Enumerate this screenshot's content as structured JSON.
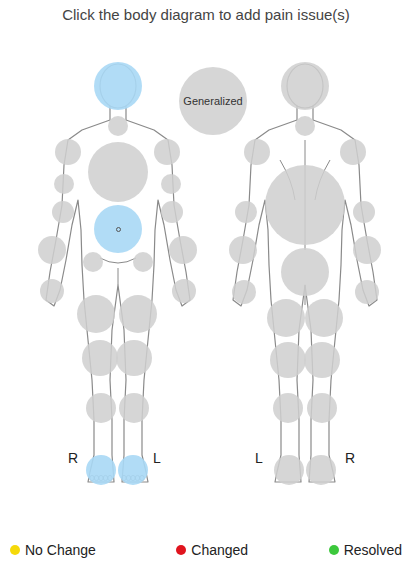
{
  "title": "Click the body diagram to add pain issue(s)",
  "generalized": {
    "label": "Generalized",
    "selected": false
  },
  "front": {
    "side_labels": [
      "R",
      "L"
    ],
    "regions": [
      {
        "name": "head",
        "selected": true,
        "marked": false
      },
      {
        "name": "neck",
        "selected": false,
        "marked": false
      },
      {
        "name": "right-shoulder",
        "selected": false,
        "marked": false
      },
      {
        "name": "left-shoulder",
        "selected": false,
        "marked": false
      },
      {
        "name": "chest",
        "selected": false,
        "marked": false
      },
      {
        "name": "right-upper-arm",
        "selected": false,
        "marked": false
      },
      {
        "name": "left-upper-arm",
        "selected": false,
        "marked": false
      },
      {
        "name": "right-elbow",
        "selected": false,
        "marked": false
      },
      {
        "name": "left-elbow",
        "selected": false,
        "marked": false
      },
      {
        "name": "abdomen",
        "selected": true,
        "marked": true
      },
      {
        "name": "right-forearm",
        "selected": false,
        "marked": false
      },
      {
        "name": "left-forearm",
        "selected": false,
        "marked": false
      },
      {
        "name": "right-hip",
        "selected": false,
        "marked": false
      },
      {
        "name": "left-hip",
        "selected": false,
        "marked": false
      },
      {
        "name": "right-hand",
        "selected": false,
        "marked": false
      },
      {
        "name": "left-hand",
        "selected": false,
        "marked": false
      },
      {
        "name": "right-upper-thigh",
        "selected": false,
        "marked": false
      },
      {
        "name": "left-upper-thigh",
        "selected": false,
        "marked": false
      },
      {
        "name": "right-lower-thigh",
        "selected": false,
        "marked": false
      },
      {
        "name": "left-lower-thigh",
        "selected": false,
        "marked": false
      },
      {
        "name": "right-knee",
        "selected": false,
        "marked": false
      },
      {
        "name": "left-knee",
        "selected": false,
        "marked": false
      },
      {
        "name": "right-foot",
        "selected": true,
        "marked": false
      },
      {
        "name": "left-foot",
        "selected": true,
        "marked": false
      }
    ]
  },
  "back": {
    "side_labels": [
      "L",
      "R"
    ],
    "regions": [
      {
        "name": "back-of-head",
        "selected": false,
        "marked": false
      },
      {
        "name": "back-of-neck",
        "selected": false,
        "marked": false
      },
      {
        "name": "left-shoulder-back",
        "selected": false,
        "marked": false
      },
      {
        "name": "right-shoulder-back",
        "selected": false,
        "marked": false
      },
      {
        "name": "upper-back",
        "selected": false,
        "marked": false
      },
      {
        "name": "left-elbow-back",
        "selected": false,
        "marked": false
      },
      {
        "name": "right-elbow-back",
        "selected": false,
        "marked": false
      },
      {
        "name": "left-forearm-back",
        "selected": false,
        "marked": false
      },
      {
        "name": "right-forearm-back",
        "selected": false,
        "marked": false
      },
      {
        "name": "lower-back",
        "selected": false,
        "marked": false
      },
      {
        "name": "left-hand-back",
        "selected": false,
        "marked": false
      },
      {
        "name": "right-hand-back",
        "selected": false,
        "marked": false
      },
      {
        "name": "left-buttock",
        "selected": false,
        "marked": false
      },
      {
        "name": "right-buttock",
        "selected": false,
        "marked": false
      },
      {
        "name": "left-hamstring",
        "selected": false,
        "marked": false
      },
      {
        "name": "right-hamstring",
        "selected": false,
        "marked": false
      },
      {
        "name": "left-calf",
        "selected": false,
        "marked": false
      },
      {
        "name": "right-calf",
        "selected": false,
        "marked": false
      },
      {
        "name": "left-heel",
        "selected": false,
        "marked": false
      },
      {
        "name": "right-heel",
        "selected": false,
        "marked": false
      }
    ]
  },
  "legend": [
    {
      "label": "No Change",
      "color": "#f5d90a"
    },
    {
      "label": "Changed",
      "color": "#e0141e"
    },
    {
      "label": "Resolved",
      "color": "#3cc83c"
    }
  ]
}
